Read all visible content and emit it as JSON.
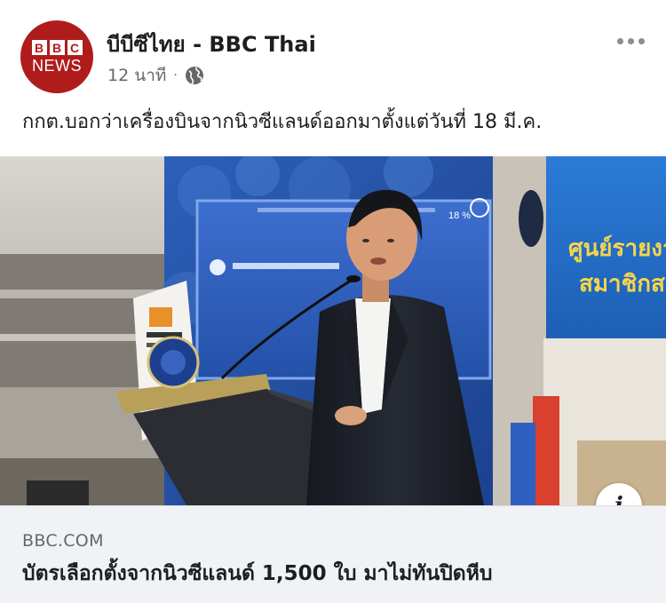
{
  "post": {
    "page_name": "บีบีซีไทย - BBC Thai",
    "timestamp": "12 นาที",
    "separator": "·",
    "audience_icon": "globe-icon",
    "text": "กกต.บอกว่าเครื่องบินจากนิวซีแลนด์ออกมาตั้งแต่วันที่ 18 มี.ค.",
    "more_icon": "more-dots-icon"
  },
  "avatar": {
    "blocks": [
      "B",
      "B",
      "C"
    ],
    "news": "NEWS",
    "color": "#b01c1c"
  },
  "photo": {
    "screen_text_line1": "ศูนย์รายงา",
    "screen_text_line2": "สมาชิกส",
    "screen_small_text": "18 %"
  },
  "link": {
    "domain": "BBC.COM",
    "title": "บัตรเลือกตั้งจากนิวซีแลนด์ 1,500 ใบ มาไม่ทันปิดหีบ",
    "info_icon": "info-icon",
    "info_glyph": "i"
  },
  "colors": {
    "text_primary": "#1c1e21",
    "text_secondary": "#65676b",
    "footer_bg": "#f0f2f5"
  }
}
